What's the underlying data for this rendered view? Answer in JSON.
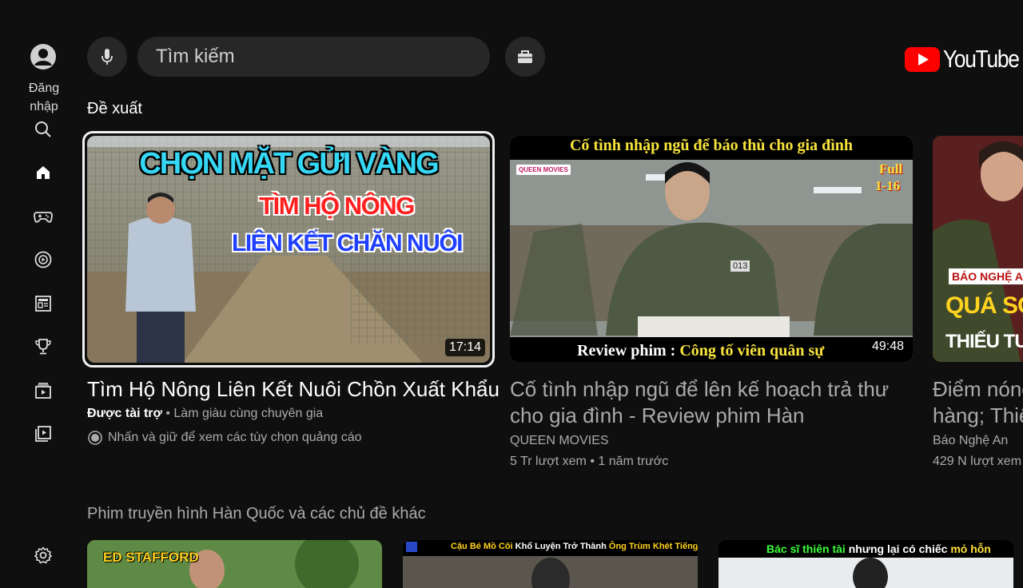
{
  "sidebar": {
    "signin_label_line1": "Đăng",
    "signin_label_line2": "nhập",
    "items": [
      {
        "icon": "search-icon"
      },
      {
        "icon": "home-icon"
      },
      {
        "icon": "gaming-icon"
      },
      {
        "icon": "music-icon"
      },
      {
        "icon": "news-icon"
      },
      {
        "icon": "trophy-icon"
      },
      {
        "icon": "movies-icon"
      },
      {
        "icon": "playlist-icon"
      },
      {
        "icon": "settings-icon"
      }
    ]
  },
  "search": {
    "placeholder": "Tìm kiếm"
  },
  "brand": {
    "logo_text": "YouTube",
    "accent": "#ff0000"
  },
  "sections": [
    {
      "title": "Đề xuất"
    },
    {
      "title": "Phim truyền hình Hàn Quốc và các chủ đề khác"
    }
  ],
  "videos": [
    {
      "title": "Tìm Hộ Nông Liên Kết Nuôi Chồn Xuất Khẩu",
      "sponsored": "Được tài trợ",
      "sep": " • ",
      "channel": "Làm giàu cùng chuyên gia",
      "hint": "Nhấn và giữ để xem các tùy chọn quảng cáo",
      "duration": "17:14",
      "thumb_lines": [
        "CHỌN MẶT GỬI VÀNG",
        "TÌM HỘ NÔNG",
        "LIÊN KẾT CHĂN NUÔI"
      ]
    },
    {
      "title_line1": "Cố tình nhập ngũ để lên kế hoạch trả thư",
      "title_line2": "cho gia đình - Review phim Hàn",
      "channel": "QUEEN MOVIES",
      "stats": "5 Tr lượt xem • 1 năm trước",
      "duration": "49:48",
      "thumb_top": "Cố tình nhập ngũ để báo thù cho gia đình",
      "thumb_bottom_a": "Review phim : ",
      "thumb_bottom_b": "Công tố viên quân sự",
      "thumb_badge": "QUEEN MOVIES",
      "thumb_full": "Full",
      "thumb_eps": "1-16",
      "thumb_tag": "013"
    },
    {
      "title_line1": "Điểm nóng",
      "title_line2": "hàng; Thiế",
      "channel": "Báo Nghệ An",
      "stats": "429 N lượt xem",
      "thumb_badge": "BÁO NGHỆ A",
      "thumb_line1": "QUÁ SỐC",
      "thumb_line2": "THIẾU TƯỚN"
    }
  ],
  "row2": [
    {
      "thumb_text": "ED STAFFORD"
    },
    {
      "thumb_text_a": "Cậu Bé Mồ Côi ",
      "thumb_text_b": "Khổ Luyện Trở Thành ",
      "thumb_text_c": "Ông Trùm Khét Tiếng"
    },
    {
      "thumb_text_a": "Bác sĩ thiên tài ",
      "thumb_text_b": "nhưng lại có chiếc ",
      "thumb_text_c": "mỏ hỗn"
    }
  ]
}
